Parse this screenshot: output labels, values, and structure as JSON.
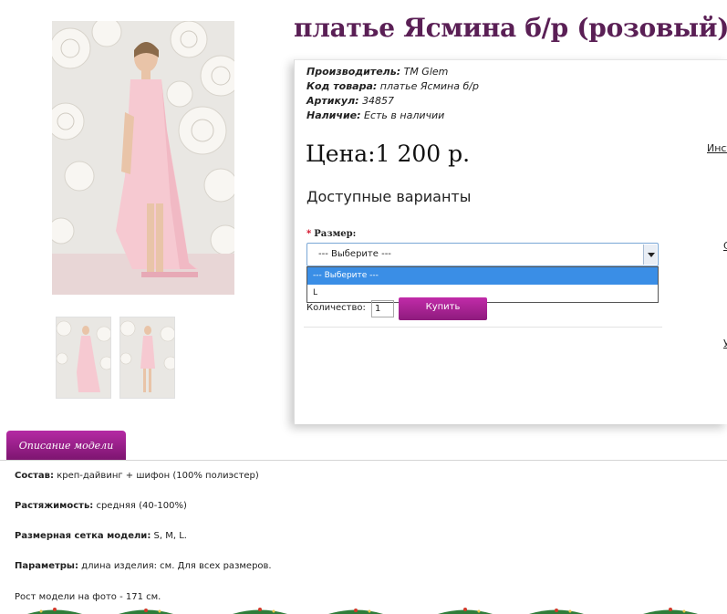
{
  "product": {
    "title": "платье Ясмина б/р (розовый)",
    "info": [
      {
        "label": "Производитель:",
        "value": "ТМ Glem"
      },
      {
        "label": "Код товара:",
        "value": "платье Ясмина б/р"
      },
      {
        "label": "Артикул:",
        "value": "34857"
      },
      {
        "label": "Наличие:",
        "value": "Есть в наличии"
      }
    ],
    "price": "Цена:1 200 р.",
    "variants_title": "Доступные варианты"
  },
  "options": {
    "size_label": "Размер:",
    "required_mark": "*",
    "select_value": "--- Выберите ---",
    "dropdown": [
      "--- Выберите ---",
      "L"
    ]
  },
  "cart": {
    "qty_label": "Количество:",
    "qty_value": "1",
    "buy_label": "Купить"
  },
  "side_links": [
    "Инст",
    "С",
    "У"
  ],
  "tabs": {
    "description": "Описание модели"
  },
  "description": [
    {
      "label": "Состав:",
      "value": " креп-дайвинг + шифон (100% полиэстер)"
    },
    {
      "label": "Растяжимость:",
      "value": " средняя (40-100%)"
    },
    {
      "label": "Размерная сетка модели:",
      "value": " S, M, L."
    },
    {
      "label": "Параметры:",
      "value": " длина изделия: см. Для всех размеров."
    },
    {
      "label": "",
      "value": "Рост модели на фото - 171 см."
    }
  ],
  "colors": {
    "title": "#5a1f55",
    "accent": "#a3248f",
    "dropdown_highlight": "#3a8ee6",
    "dress": "#f4c3cc"
  }
}
